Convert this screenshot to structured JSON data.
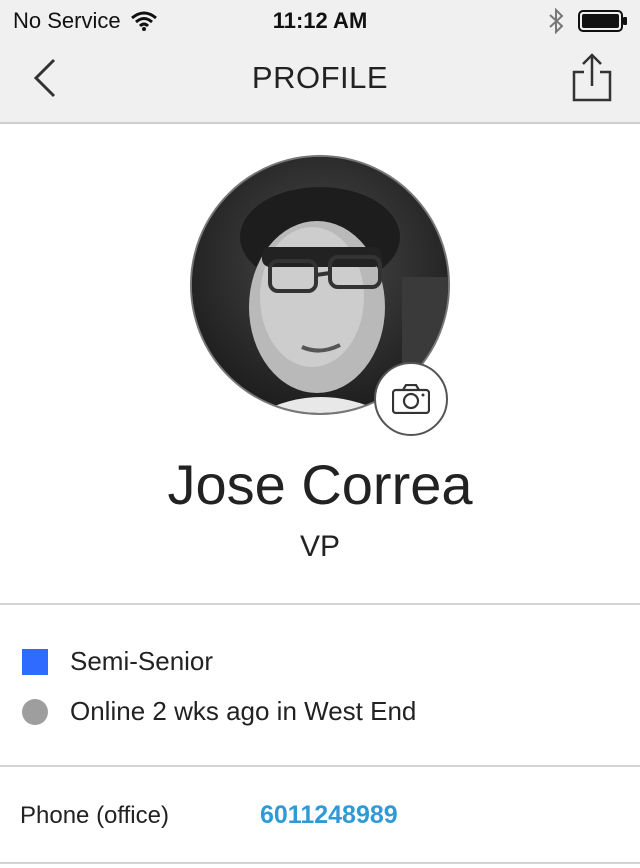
{
  "status_bar": {
    "carrier": "No Service",
    "time": "11:12 AM",
    "icons": [
      "wifi-icon",
      "bluetooth-icon",
      "battery-icon"
    ]
  },
  "nav": {
    "title": "PROFILE",
    "back_icon": "chevron-left-icon",
    "share_icon": "share-icon"
  },
  "profile": {
    "name": "Jose Correa",
    "role": "VP",
    "camera_icon": "camera-icon"
  },
  "details": {
    "level_label": "Semi-Senior",
    "level_color": "#2f6bff",
    "presence_text": "Online 2 wks ago in West End",
    "presence_color": "#9e9e9e"
  },
  "contact": {
    "phone_label": "Phone (office)",
    "phone_value": "6011248989",
    "link_color": "#2f9ad8"
  }
}
